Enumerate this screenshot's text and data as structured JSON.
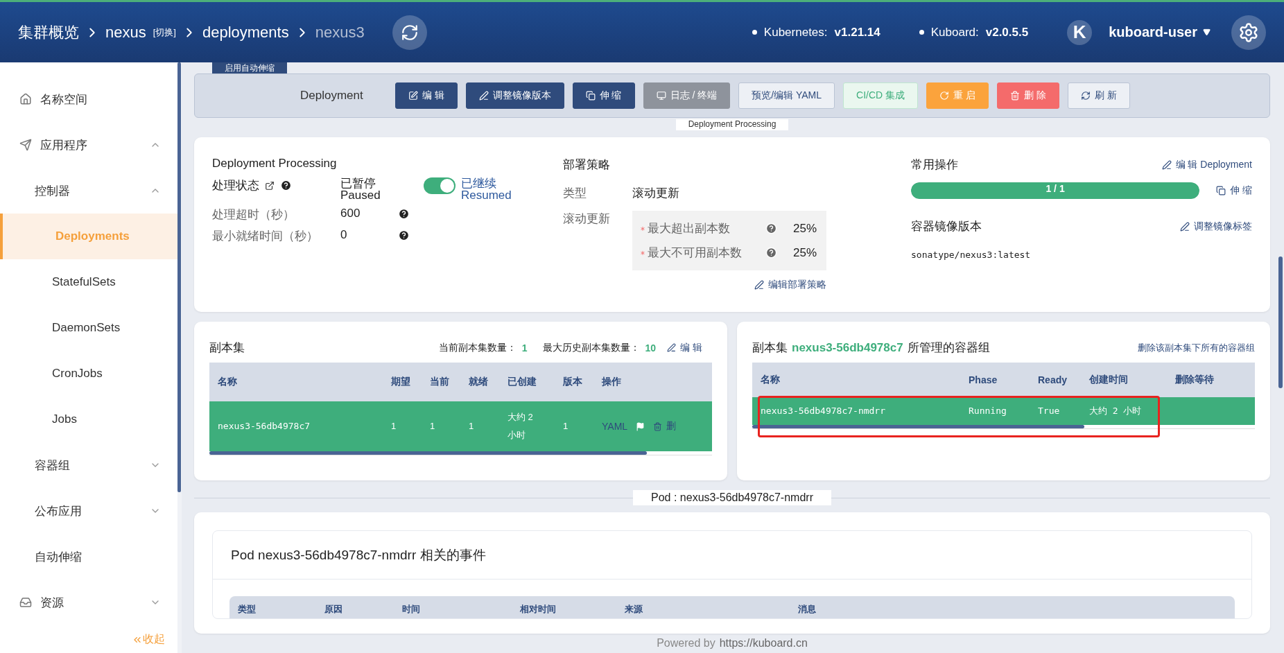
{
  "header": {
    "breadcrumb": [
      {
        "label": "集群概览",
        "current": false
      },
      {
        "label": "nexus",
        "current": false,
        "switch": "[切换]"
      },
      {
        "label": "deployments",
        "current": false
      },
      {
        "label": "nexus3",
        "current": true
      }
    ],
    "versions": [
      {
        "label": "Kubernetes:",
        "value": "v1.21.14"
      },
      {
        "label": "Kuboard:",
        "value": "v2.0.5.5"
      }
    ],
    "user": {
      "avatar": "K",
      "name": "kuboard-user"
    }
  },
  "sidebar": {
    "items": [
      {
        "label": "名称空间",
        "selected": false
      },
      {
        "label": "应用程序",
        "selected": false,
        "expanded": true,
        "children": [
          {
            "label": "控制器",
            "selected": false,
            "expanded": true,
            "children": [
              {
                "label": "Deployments",
                "selected": true
              },
              {
                "label": "StatefulSets",
                "selected": false
              },
              {
                "label": "DaemonSets",
                "selected": false
              },
              {
                "label": "CronJobs",
                "selected": false
              },
              {
                "label": "Jobs",
                "selected": false
              }
            ]
          },
          {
            "label": "容器组",
            "selected": false,
            "expanded": false
          },
          {
            "label": "公布应用",
            "selected": false,
            "expanded": false
          },
          {
            "label": "自动伸缩",
            "selected": false
          }
        ]
      },
      {
        "label": "资源",
        "selected": false,
        "expanded": false
      }
    ],
    "collapse": "收起"
  },
  "toolbar": {
    "tab": "启用自动伸缩",
    "title": "Deployment",
    "buttons": [
      {
        "label": "编 辑",
        "kind": "primary"
      },
      {
        "label": "调整镜像版本",
        "kind": "primary"
      },
      {
        "label": "伸 缩",
        "kind": "primary"
      },
      {
        "label": "日志 / 终端",
        "kind": "gray"
      },
      {
        "label": "预览/编辑 YAML",
        "kind": "plain"
      },
      {
        "label": "CI/CD 集成",
        "kind": "success"
      },
      {
        "label": "重 启",
        "kind": "warning"
      },
      {
        "label": "删 除",
        "kind": "danger"
      },
      {
        "label": "刷 新",
        "kind": "plain"
      }
    ],
    "section_tag": "Deployment Processing"
  },
  "processing": {
    "title": "Deployment Processing",
    "status_label": "处理状态",
    "status_value": "已暂停",
    "status_value_en": "Paused",
    "toggle_on": true,
    "toggle_label": "已继续",
    "toggle_label_en": "Resumed",
    "rows": [
      {
        "label": "处理超时（秒）",
        "value": "600"
      },
      {
        "label": "最小就绪时间（秒）",
        "value": "0"
      }
    ]
  },
  "strategy": {
    "title": "部署策略",
    "type_label": "类型",
    "type_value": "滚动更新",
    "rolling_label": "滚动更新",
    "rows": [
      {
        "label": "最大超出副本数",
        "value": "25%"
      },
      {
        "label": "最大不可用副本数",
        "value": "25%"
      }
    ],
    "edit_link": "编辑部署策略"
  },
  "operations": {
    "title": "常用操作",
    "edit_link": "编 辑 Deployment",
    "replicas": {
      "text": "1 / 1",
      "level": 1
    },
    "scale_link": "伸 缩",
    "image_title": "容器镜像版本",
    "image_link": "调整镜像标签",
    "image": "sonatype/nexus3:latest"
  },
  "replicasets": {
    "title": "副本集",
    "current_label": "当前副本集数量：",
    "current": "1",
    "history_label": "最大历史副本集数量：",
    "history": "10",
    "edit_link": "编 辑",
    "columns": [
      "名称",
      "期望",
      "当前",
      "就绪",
      "已创建",
      "版本",
      "操作"
    ],
    "rows": [
      {
        "name": "nexus3-56db4978c7",
        "desired": "1",
        "current": "1",
        "ready": "1",
        "created": "大约 2 小时",
        "version": "1",
        "yaml": "YAML",
        "delete": "删"
      }
    ]
  },
  "pods": {
    "title_prefix": "副本集",
    "replicaset": "nexus3-56db4978c7",
    "title_suffix": "所管理的容器组",
    "delete_link": "删除该副本集下所有的容器组",
    "columns": [
      "名称",
      "Phase",
      "Ready",
      "创建时间",
      "删除等待"
    ],
    "rows": [
      {
        "name": "nexus3-56db4978c7-nmdrr",
        "phase": "Running",
        "ready": "True",
        "created": "大约 2 小时",
        "highlighted": true
      }
    ]
  },
  "pod_divider": "Pod : nexus3-56db4978c7-nmdrr",
  "events": {
    "title": "Pod nexus3-56db4978c7-nmdrr 相关的事件",
    "columns": [
      "类型",
      "原因",
      "时间",
      "相对时间",
      "来源",
      "消息"
    ]
  },
  "footer": {
    "prefix": "Powered by",
    "link": "https://kuboard.cn"
  }
}
